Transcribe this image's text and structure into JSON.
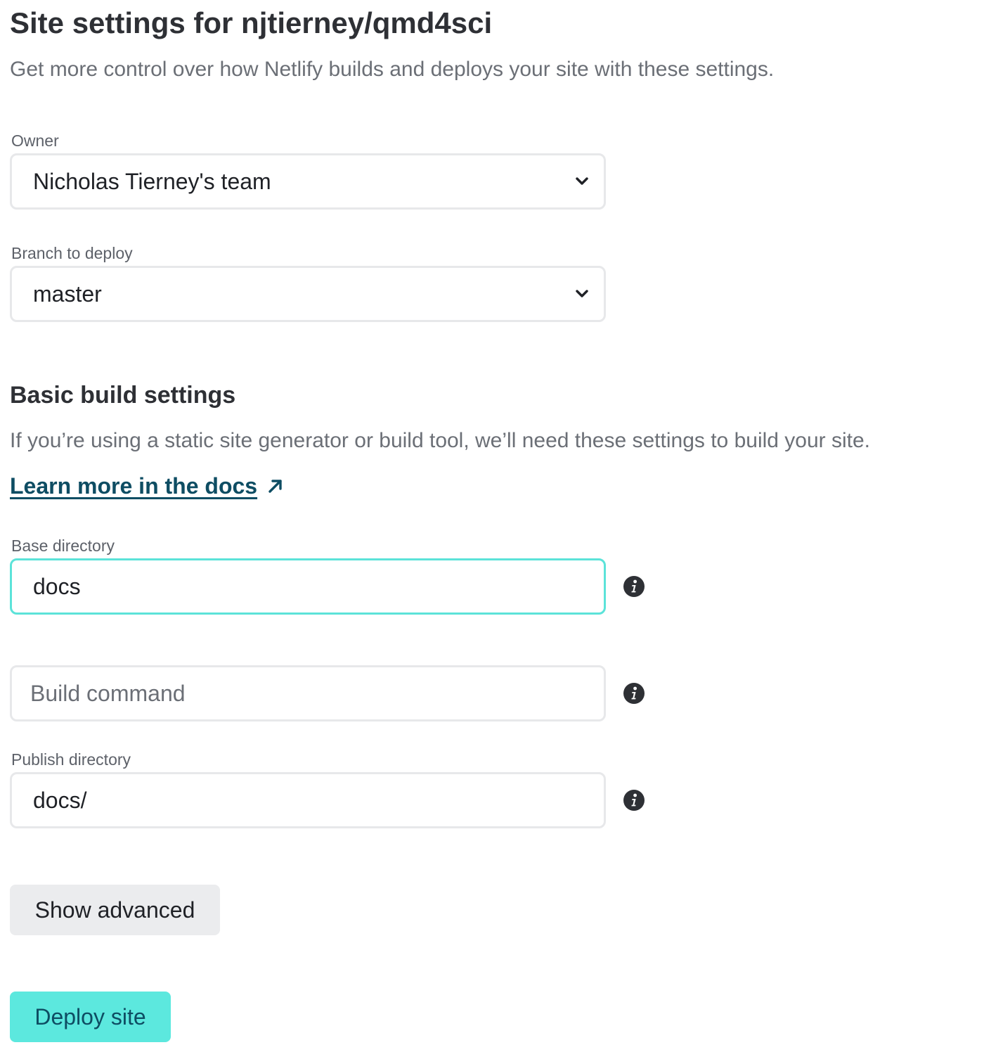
{
  "header": {
    "title": "Site settings for njtierney/qmd4sci",
    "subtitle": "Get more control over how Netlify builds and deploys your site with these settings."
  },
  "owner": {
    "label": "Owner",
    "selected": "Nicholas Tierney's team",
    "icon": "chevron-down-icon"
  },
  "branch": {
    "label": "Branch to deploy",
    "selected": "master",
    "icon": "chevron-down-icon"
  },
  "build_settings": {
    "title": "Basic build settings",
    "description": "If you’re using a static site generator or build tool, we’ll need these settings to build your site.",
    "docs_link": "Learn more in the docs",
    "docs_link_icon": "external-arrow-icon",
    "base_directory": {
      "label": "Base directory",
      "value": "docs",
      "focused": true,
      "icon": "info-icon"
    },
    "build_command": {
      "placeholder": "Build command",
      "value": "",
      "icon": "info-icon"
    },
    "publish_directory": {
      "label": "Publish directory",
      "value": "docs/",
      "icon": "info-icon"
    }
  },
  "actions": {
    "show_advanced": "Show advanced",
    "deploy": "Deploy site"
  },
  "colors": {
    "accent": "#5ce3d9",
    "link": "#0e4d63",
    "text": "#2e3035",
    "muted_text": "#6b6f76",
    "secondary_button_bg": "#ebecee",
    "border": "#e7e8ea"
  }
}
